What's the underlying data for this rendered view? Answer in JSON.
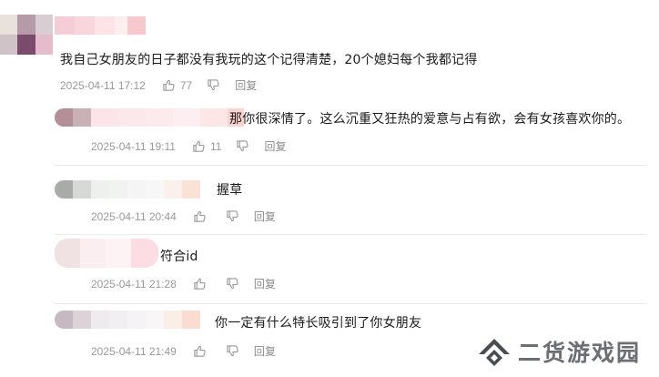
{
  "comments": [
    {
      "text": "我自己女朋友的日子都没有我玩的这个记得清楚，20个媳妇每个我都记得",
      "time": "2025-04-11 17:12",
      "likes": "77",
      "reply_label": "回复"
    },
    {
      "text": "那你很深情了。这么沉重又狂热的爱意与占有欲，会有女孩喜欢你的。",
      "time": "2025-04-11 19:11",
      "likes": "11",
      "reply_label": "回复"
    },
    {
      "text": "握草",
      "time": "2025-04-11 20:44",
      "likes": "",
      "reply_label": "回复"
    },
    {
      "text": "符合id",
      "time": "2025-04-11 21:28",
      "likes": "",
      "reply_label": "回复"
    },
    {
      "text": "你一定有什么特长吸引到了你女朋友",
      "time": "2025-04-11 21:49",
      "likes": "",
      "reply_label": "回复"
    }
  ],
  "icons": {
    "like": "thumbs-up-icon",
    "dislike": "thumbs-down-icon"
  },
  "watermark": {
    "text": "二货游戏园"
  },
  "colors": {
    "meta": "#9a9a9a",
    "text": "#1a1a1a",
    "watermark": "#6b6f74"
  }
}
